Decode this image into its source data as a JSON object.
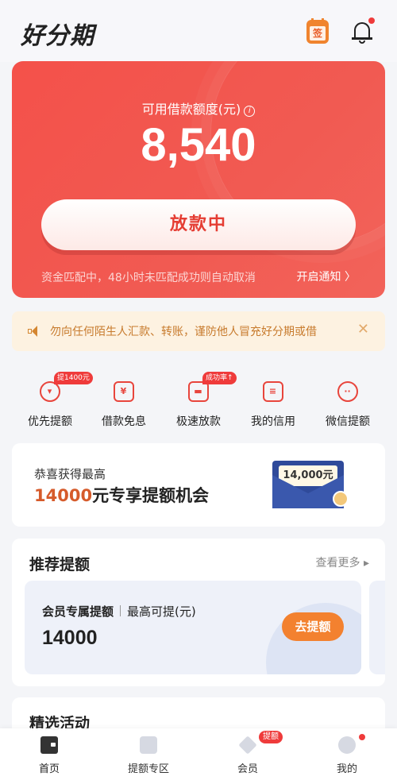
{
  "header": {
    "logo": "好分期",
    "sign_label": "签"
  },
  "credit": {
    "label": "可用借款额度(元)",
    "info_symbol": "i",
    "amount": "8,540",
    "status_button": "放款中",
    "note": "资金匹配中，48小时未匹配成功则自动取消",
    "notify_link": "开启通知 〉"
  },
  "notice": {
    "text": "勿向任何陌生人汇款、转账，谨防他人冒充好分期或借",
    "close": "✕"
  },
  "quick": [
    {
      "label": "优先提额",
      "glyph": "▾",
      "tag": "提1400元"
    },
    {
      "label": "借款免息",
      "glyph": "¥",
      "tag": ""
    },
    {
      "label": "极速放款",
      "glyph": "▬",
      "tag": "成功率↑"
    },
    {
      "label": "我的信用",
      "glyph": "≡",
      "tag": ""
    },
    {
      "label": "微信提额",
      "glyph": "··",
      "tag": ""
    }
  ],
  "promo": {
    "line1": "恭喜获得最高",
    "amount": "14000",
    "line2_rest": "元专享提额机会",
    "envelope_text": "14,000元"
  },
  "recommend": {
    "title": "推荐提额",
    "more": "查看更多 ▸",
    "card": {
      "name": "会员专属提额",
      "sub": "最高可提(元)",
      "amount": "14000",
      "button": "去提额"
    }
  },
  "activities": {
    "title": "精选活动"
  },
  "tabbar": [
    {
      "label": "首页",
      "badge": ""
    },
    {
      "label": "提额专区",
      "badge": ""
    },
    {
      "label": "会员",
      "badge": "提额"
    },
    {
      "label": "我的",
      "badge": ""
    }
  ],
  "colors": {
    "brand_red": "#f4514a",
    "accent_orange": "#f3812f",
    "notice_bg": "#fdf2e1"
  }
}
